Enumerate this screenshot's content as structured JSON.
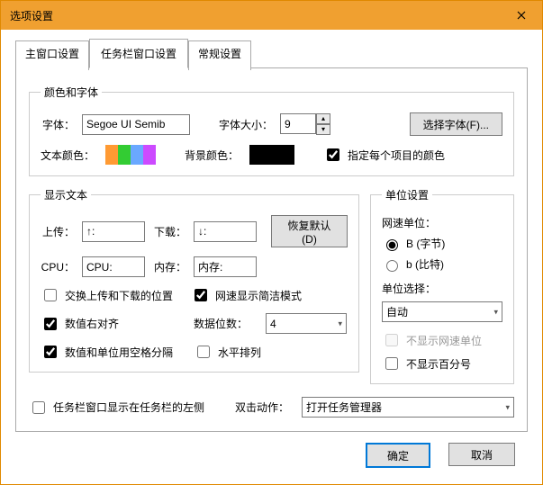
{
  "window": {
    "title": "选项设置"
  },
  "tabs": {
    "main": "主窗口设置",
    "taskbar": "任务栏窗口设置",
    "general": "常规设置"
  },
  "group_color": {
    "legend": "颜色和字体",
    "font_label": "字体：",
    "font_value": "Segoe UI Semib",
    "size_label": "字体大小：",
    "size_value": "9",
    "choose_font": "选择字体(F)...",
    "text_color_label": "文本颜色：",
    "bg_color_label": "背景颜色：",
    "per_item_label": "指定每个项目的颜色",
    "swatches": [
      "#ff9a33",
      "#33cc33",
      "#6aa8ff",
      "#cc4aff"
    ]
  },
  "group_display": {
    "legend": "显示文本",
    "upload_label": "上传：",
    "upload_value": "↑:",
    "download_label": "下载：",
    "download_value": "↓:",
    "cpu_label": "CPU：",
    "cpu_value": "CPU:",
    "mem_label": "内存：",
    "mem_value": "内存:",
    "restore_default": "恢复默认(D)",
    "swap_label": "交换上传和下载的位置",
    "compact_label": "网速显示简洁模式",
    "align_right_label": "数值右对齐",
    "digits_label": "数据位数：",
    "digits_value": "4",
    "space_sep_label": "数值和单位用空格分隔",
    "horizontal_label": "水平排列"
  },
  "group_unit": {
    "legend": "单位设置",
    "netunit_label": "网速单位：",
    "opt_byte": "B (字节)",
    "opt_bit": "b (比特)",
    "unit_select_label": "单位选择：",
    "unit_select_value": "自动",
    "hide_netunit_label": "不显示网速单位",
    "hide_percent_label": "不显示百分号"
  },
  "bottom": {
    "taskbar_left_label": "任务栏窗口显示在任务栏的左侧",
    "dblclick_label": "双击动作：",
    "dblclick_value": "打开任务管理器"
  },
  "buttons": {
    "ok": "确定",
    "cancel": "取消"
  }
}
